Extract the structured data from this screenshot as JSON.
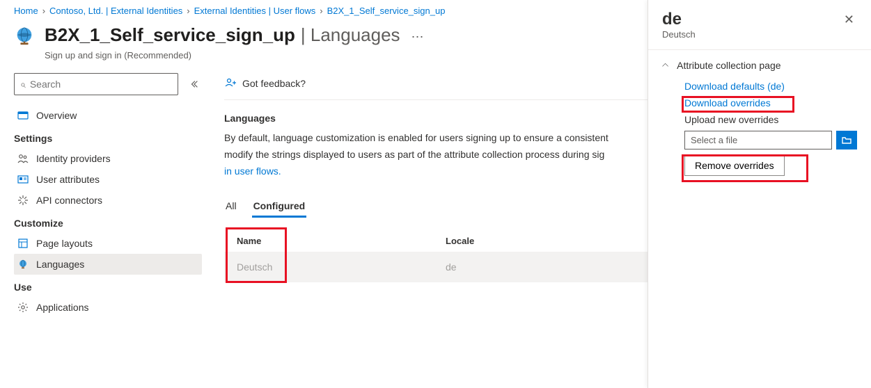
{
  "breadcrumbs": [
    "Home",
    "Contoso, Ltd. | External Identities",
    "External Identities | User flows",
    "B2X_1_Self_service_sign_up"
  ],
  "header": {
    "title_main": "B2X_1_Self_service_sign_up",
    "title_suffix": "| Languages",
    "subtitle": "Sign up and sign in (Recommended)"
  },
  "sidebar": {
    "search_placeholder": "Search",
    "overview": "Overview",
    "sections": {
      "settings": "Settings",
      "customize": "Customize",
      "use": "Use"
    },
    "items": {
      "identity_providers": "Identity providers",
      "user_attributes": "User attributes",
      "api_connectors": "API connectors",
      "page_layouts": "Page layouts",
      "languages": "Languages",
      "applications": "Applications"
    }
  },
  "main": {
    "feedback": "Got feedback?",
    "section_title": "Languages",
    "para_1": "By default, language customization is enabled for users signing up to ensure a consistent",
    "para_2": "modify the strings displayed to users as part of the attribute collection process during sig",
    "link": "in user flows.",
    "tabs": {
      "all": "All",
      "configured": "Configured"
    },
    "table": {
      "col_name": "Name",
      "col_locale": "Locale",
      "row": {
        "name": "Deutsch",
        "locale": "de"
      }
    }
  },
  "panel": {
    "title": "de",
    "subtitle": "Deutsch",
    "section": "Attribute collection page",
    "download_defaults": "Download defaults (de)",
    "download_overrides": "Download overrides",
    "upload_label": "Upload new overrides",
    "file_placeholder": "Select a file",
    "remove_btn": "Remove overrides"
  }
}
